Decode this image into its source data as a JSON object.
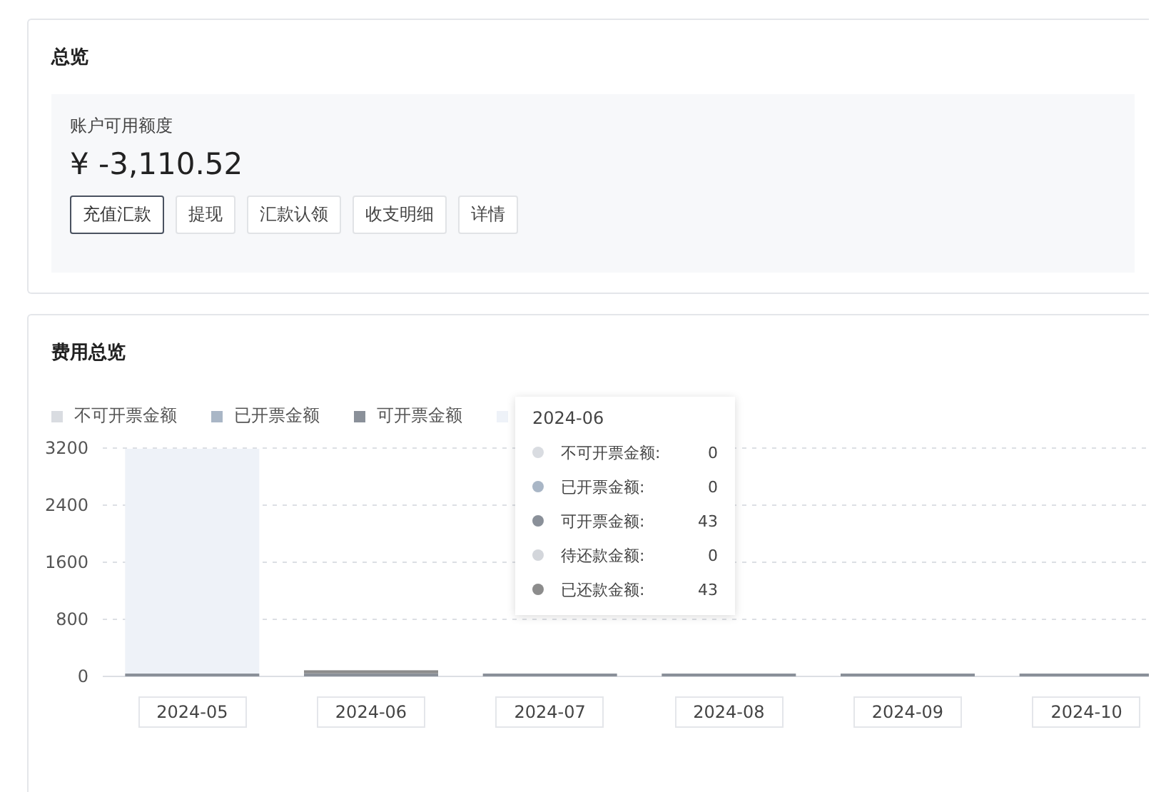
{
  "overview": {
    "title": "总览",
    "balance_label": "账户可用额度",
    "balance": "¥ -3,110.52",
    "buttons": [
      {
        "label": "充值汇款",
        "selected": true
      },
      {
        "label": "提现",
        "selected": false
      },
      {
        "label": "汇款认领",
        "selected": false
      },
      {
        "label": "收支明细",
        "selected": false
      },
      {
        "label": "详情",
        "selected": false
      }
    ]
  },
  "expenses": {
    "title": "费用总览",
    "chart_data": {
      "type": "bar",
      "categories": [
        "2024-05",
        "2024-06",
        "2024-07",
        "2024-08",
        "2024-09",
        "2024-10"
      ],
      "ylim": [
        0,
        3200
      ],
      "yticks": [
        0,
        800,
        1600,
        2400,
        3200
      ],
      "stacked": true,
      "grid": true,
      "series": [
        {
          "name": "不可开票金额",
          "color": "#d9dce1",
          "values": [
            0,
            0,
            0,
            0,
            0,
            0
          ]
        },
        {
          "name": "已开票金额",
          "color": "#a9b6c6",
          "values": [
            0,
            0,
            0,
            0,
            0,
            0
          ]
        },
        {
          "name": "可开票金额",
          "color": "#8a9099",
          "values": [
            40,
            43,
            40,
            40,
            40,
            40
          ]
        },
        {
          "color": "#eef2f8",
          "values": [
            3150,
            0,
            0,
            0,
            0,
            0
          ]
        },
        {
          "color": "#8c8c8c",
          "values": [
            0,
            43,
            0,
            0,
            0,
            0
          ]
        }
      ]
    },
    "tooltip": {
      "title": "2024-06",
      "rows": [
        {
          "label": "不可开票金额:",
          "value": "0",
          "color": "#d9dce1"
        },
        {
          "label": "已开票金额:",
          "value": "0",
          "color": "#a9b6c6"
        },
        {
          "label": "可开票金额:",
          "value": "43",
          "color": "#8a9099"
        },
        {
          "label": "待还款金额:",
          "value": "0",
          "color": "#d3d6db"
        },
        {
          "label": "已还款金额:",
          "value": "43",
          "color": "#8c8c8c"
        }
      ]
    }
  }
}
